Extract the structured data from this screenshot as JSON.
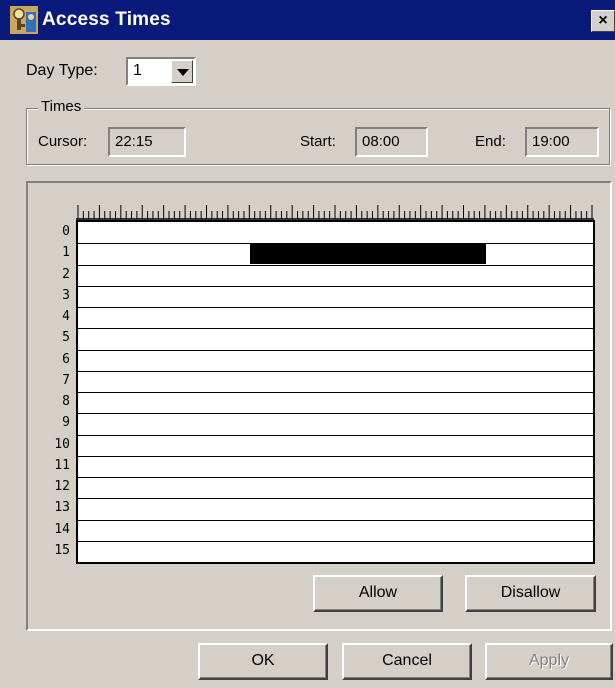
{
  "window": {
    "title": "Access Times",
    "close_label": "×"
  },
  "day_type": {
    "label": "Day Type:",
    "value": "1"
  },
  "times": {
    "group_label": "Times",
    "cursor_label": "Cursor:",
    "cursor_value": "22:15",
    "start_label": "Start:",
    "start_value": "08:00",
    "end_label": "End:",
    "end_value": "19:00"
  },
  "schedule": {
    "row_labels": [
      "0",
      "1",
      "2",
      "3",
      "4",
      "5",
      "6",
      "7",
      "8",
      "9",
      "10",
      "11",
      "12",
      "13",
      "14",
      "15"
    ],
    "allowed": [
      {
        "row": 1,
        "start": "08:00",
        "end": "19:00"
      }
    ]
  },
  "buttons": {
    "allow": "Allow",
    "disallow": "Disallow",
    "ok": "OK",
    "cancel": "Cancel",
    "apply": "Apply"
  },
  "colors": {
    "title_bar": "#0a1a7a",
    "face": "#d4d0c8",
    "allowed_fill": "#000000"
  }
}
